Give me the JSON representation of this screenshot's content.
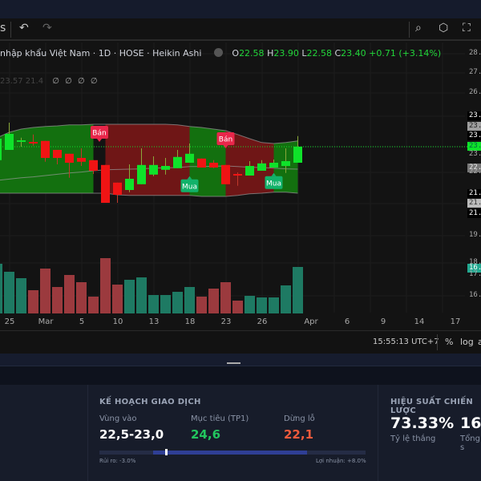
{
  "toolbar": {
    "left_partial": "s",
    "undo_icon": "undo-icon",
    "redo_icon": "redo-icon",
    "right_icons": [
      "quick-search-icon",
      "settings-icon",
      "fullscreen-icon"
    ]
  },
  "legend": {
    "title": "nhập khẩu Việt Nam · 1D · HOSE · Heikin Ashi",
    "o_label": "O",
    "o": "22.58",
    "h_label": "H",
    "h": "23.90",
    "l_label": "L",
    "l": "22.58",
    "c_label": "C",
    "c": "23.40",
    "change": "+0.71 (+3.14%)",
    "indicator_values": "23.57 21.4",
    "indicator_placeholders": "∅ ∅ ∅ ∅"
  },
  "colors": {
    "up": "#0fe22a",
    "down": "#f01414",
    "vol_up": "#1e7a63",
    "vol_down": "#9b3a3e",
    "band_up": "#13700f",
    "band_down": "#6f1616",
    "buy": "#12b26a",
    "sell": "#e8264a"
  },
  "chart_data": {
    "type": "candlestick",
    "candles": [
      [
        22.98,
        23.73,
        22.85,
        23.65
      ],
      [
        23.3,
        24.15,
        23.3,
        23.8
      ],
      [
        23.55,
        23.68,
        23.4,
        23.6
      ],
      [
        23.55,
        23.78,
        23.43,
        23.5
      ],
      [
        23.58,
        23.58,
        22.93,
        23.05
      ],
      [
        23.3,
        23.3,
        22.85,
        23.05
      ],
      [
        23.18,
        23.18,
        22.43,
        22.9
      ],
      [
        23.05,
        23.35,
        22.8,
        22.93
      ],
      [
        22.98,
        22.98,
        22.55,
        22.65
      ],
      [
        22.83,
        22.83,
        21.65,
        21.65
      ],
      [
        22.28,
        22.28,
        21.65,
        21.9
      ],
      [
        22.05,
        22.85,
        21.98,
        22.4
      ],
      [
        22.23,
        23.35,
        22.23,
        22.83
      ],
      [
        22.53,
        23.1,
        22.48,
        22.83
      ],
      [
        22.68,
        23.05,
        22.53,
        22.8
      ],
      [
        22.73,
        23.3,
        22.73,
        23.08
      ],
      [
        22.9,
        23.5,
        22.9,
        23.18
      ],
      [
        23.03,
        23.03,
        22.75,
        22.75
      ],
      [
        22.9,
        22.98,
        22.73,
        22.75
      ],
      [
        22.83,
        22.83,
        22.23,
        22.23
      ],
      [
        22.55,
        22.6,
        22.18,
        22.5
      ],
      [
        22.5,
        22.95,
        22.5,
        22.8
      ],
      [
        22.65,
        22.98,
        22.65,
        22.88
      ],
      [
        22.75,
        23.0,
        22.75,
        22.9
      ],
      [
        22.8,
        23.35,
        22.58,
        22.95
      ],
      [
        22.9,
        23.73,
        22.9,
        23.4
      ]
    ],
    "volume": [
      62,
      52,
      44,
      29,
      56,
      33,
      48,
      39,
      21,
      69,
      36,
      42,
      45,
      23,
      23,
      27,
      33,
      21,
      31,
      39,
      16,
      22,
      20,
      20,
      35,
      58
    ],
    "band_upper": [
      23.68,
      23.85,
      23.95,
      24.0,
      24.03,
      24.05,
      24.08,
      24.08,
      24.1,
      24.1,
      24.1,
      24.1,
      24.1,
      24.1,
      24.1,
      24.08,
      24.03,
      24.0,
      23.95,
      23.9,
      23.78,
      23.65,
      23.53,
      23.5,
      23.53,
      23.58
    ],
    "band_middle": [
      22.35,
      22.39,
      22.43,
      22.46,
      22.5,
      22.54,
      22.58,
      22.61,
      22.65,
      22.68,
      22.69,
      22.7,
      22.71,
      22.73,
      22.74,
      22.75,
      22.78,
      22.78,
      22.79,
      22.8,
      22.78,
      22.76,
      22.75,
      22.73,
      22.71,
      22.7
    ],
    "band_lower": [
      21.95,
      21.95,
      21.95,
      21.95,
      21.95,
      21.95,
      21.95,
      21.95,
      21.95,
      21.95,
      21.9,
      21.88,
      21.88,
      21.88,
      21.88,
      21.88,
      21.88,
      21.85,
      21.85,
      21.85,
      21.88,
      21.93,
      21.95,
      21.98,
      21.98,
      21.95
    ],
    "regimes": [
      {
        "from": 0,
        "to": 8,
        "side": "up"
      },
      {
        "from": 9,
        "to": 16,
        "side": "down"
      },
      {
        "from": 16,
        "to": 19,
        "side": "up"
      },
      {
        "from": 19,
        "to": 23,
        "side": "down"
      },
      {
        "from": 23,
        "to": 25,
        "side": "up"
      }
    ],
    "signals": [
      {
        "index": 8.5,
        "label": "Bán",
        "side": "sell"
      },
      {
        "index": 16,
        "label": "Mua",
        "side": "buy"
      },
      {
        "index": 19,
        "label": "Bán",
        "side": "sell"
      },
      {
        "index": 23,
        "label": "Mua",
        "side": "buy"
      }
    ],
    "last_price": 23.4,
    "price_labels": [
      {
        "text": "28.",
        "style": "plain"
      },
      {
        "text": "27.",
        "style": "plain"
      },
      {
        "text": "26.",
        "style": "plain"
      },
      {
        "text": "23.",
        "style": "black"
      },
      {
        "text": "23.",
        "style": "gray"
      },
      {
        "text": "23.",
        "style": "black"
      },
      {
        "text": "23.",
        "style": "green"
      },
      {
        "text": "23.",
        "style": "plain"
      },
      {
        "text": "22.",
        "style": "dark"
      },
      {
        "text": "22.",
        "style": "plain"
      },
      {
        "text": "21.",
        "style": "black"
      },
      {
        "text": "21.",
        "style": "light"
      },
      {
        "text": "21.",
        "style": "black"
      },
      {
        "text": "19.",
        "style": "plain"
      },
      {
        "text": "18.",
        "style": "plain"
      },
      {
        "text": "16.",
        "style": "teal"
      },
      {
        "text": "17.",
        "style": "plain"
      },
      {
        "text": "16.",
        "style": "plain"
      }
    ],
    "x_labels": [
      "25",
      "Mar",
      "5",
      "10",
      "13",
      "18",
      "23",
      "26",
      "Apr",
      "6",
      "9",
      "14",
      "17"
    ]
  },
  "bottom_bar": {
    "time": "15:55:13 UTC+7",
    "percent": "%",
    "log": "log",
    "auto": "a"
  },
  "trade_plan": {
    "heading": "KẾ HOẠCH GIAO DỊCH",
    "entry_label": "Vùng vào",
    "entry": "22,5-23,0",
    "target_label": "Mục tiêu (TP1)",
    "target": "24,6",
    "stop_label": "Dừng lỗ",
    "stop": "22,1",
    "risk": "Rủi ro: -3.0%",
    "reward": "Lợi nhuận: +8.0%"
  },
  "performance": {
    "heading": "HIỆU SUẤT CHIẾN LƯỢC",
    "win_rate": "73.33%",
    "win_rate_label": "Tỷ lệ thắng",
    "total": "16",
    "total_label": "Tổng s"
  }
}
